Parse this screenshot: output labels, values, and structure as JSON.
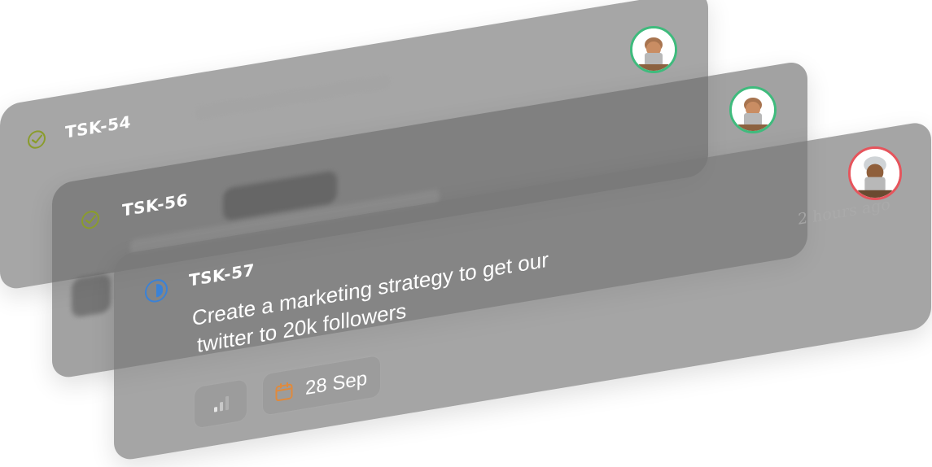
{
  "cards": [
    {
      "id": "TSK-54",
      "status": "done",
      "assignee_ring": "#3fbb7d"
    },
    {
      "id": "TSK-56",
      "status": "done",
      "assignee_ring": "#3fbb7d"
    },
    {
      "id": "TSK-57",
      "status": "in-progress",
      "title_line1": "Create a marketing strategy to get our",
      "title_line2": "twitter to 20k followers",
      "time_ago": "2 hours ago",
      "priority_icon": "signal-bars-icon",
      "due_icon": "calendar-icon",
      "due_date": "28 Sep",
      "assignee_ring": "#e6545c"
    }
  ],
  "colors": {
    "done": "#8a9c2c",
    "in_progress": "#3b82d6",
    "calendar": "#e08a3c"
  }
}
